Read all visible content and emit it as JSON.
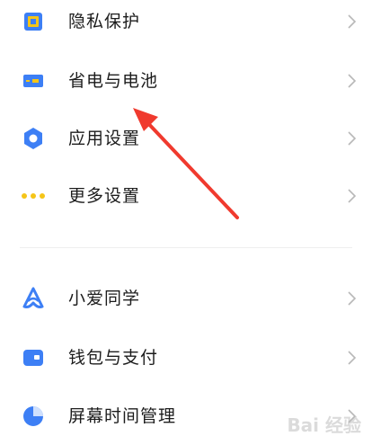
{
  "menu_group_1": [
    {
      "label": "隐私保护",
      "icon": "privacy-shield-icon"
    },
    {
      "label": "省电与电池",
      "icon": "battery-icon"
    },
    {
      "label": "应用设置",
      "icon": "gear-icon"
    },
    {
      "label": "更多设置",
      "icon": "more-dots-icon"
    }
  ],
  "menu_group_2": [
    {
      "label": "小爱同学",
      "icon": "xiaoai-assistant-icon"
    },
    {
      "label": "钱包与支付",
      "icon": "wallet-icon"
    },
    {
      "label": "屏幕时间管理",
      "icon": "screen-time-pie-icon"
    }
  ],
  "watermark": {
    "text": "Bai 经验"
  },
  "colors": {
    "accent_blue": "#3d7ff5",
    "accent_yellow": "#f5c518",
    "annotation_red": "#f03a2e"
  }
}
